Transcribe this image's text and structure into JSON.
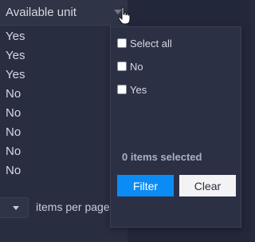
{
  "column": {
    "title": "Available unit",
    "rows": [
      "Yes",
      "Yes",
      "Yes",
      "No",
      "No",
      "No",
      "No",
      "No"
    ]
  },
  "pagination": {
    "page_size_value": "",
    "items_per_page_label": "items per page"
  },
  "filter_popup": {
    "options": [
      {
        "label": "Select all",
        "checked": false
      },
      {
        "label": "No",
        "checked": false
      },
      {
        "label": "Yes",
        "checked": false
      }
    ],
    "selected_count_text": "0 items selected",
    "filter_button": "Filter",
    "clear_button": "Clear"
  },
  "icons": {
    "header_filter": "chevron-down-icon",
    "cursor": "hand-pointer-icon",
    "pager_dropdown": "caret-down-icon"
  },
  "colors": {
    "primary": "#0b8cf4",
    "background": "#262a3b",
    "popup_bg": "#2c3045"
  }
}
